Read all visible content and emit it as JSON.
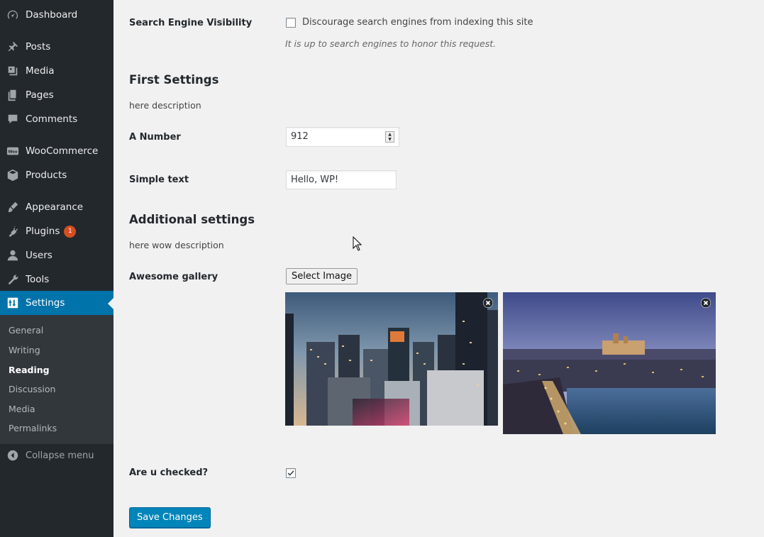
{
  "sidebar": {
    "items": [
      {
        "label": "Dashboard",
        "icon": "dashboard-icon"
      },
      {
        "label": "Posts",
        "icon": "pin-icon"
      },
      {
        "label": "Media",
        "icon": "media-icon"
      },
      {
        "label": "Pages",
        "icon": "pages-icon"
      },
      {
        "label": "Comments",
        "icon": "comment-icon"
      },
      {
        "label": "WooCommerce",
        "icon": "woocommerce-icon"
      },
      {
        "label": "Products",
        "icon": "products-icon"
      },
      {
        "label": "Appearance",
        "icon": "brush-icon"
      },
      {
        "label": "Plugins",
        "icon": "plugin-icon",
        "badge": "1"
      },
      {
        "label": "Users",
        "icon": "user-icon"
      },
      {
        "label": "Tools",
        "icon": "wrench-icon"
      },
      {
        "label": "Settings",
        "icon": "settings-icon",
        "active": true
      }
    ],
    "submenu": [
      "General",
      "Writing",
      "Reading",
      "Discussion",
      "Media",
      "Permalinks"
    ],
    "current_submenu": "Reading",
    "collapse_label": "Collapse menu",
    "accent_color": "#0073aa",
    "badge_color": "#d54e21"
  },
  "main": {
    "search_visibility": {
      "label": "Search Engine Visibility",
      "checkbox_label": "Discourage search engines from indexing this site",
      "checked": false,
      "description": "It is up to search engines to honor this request."
    },
    "first_settings": {
      "title": "First Settings",
      "description": "here description",
      "number_label": "A Number",
      "number_value": "912",
      "text_label": "Simple text",
      "text_value": "Hello, WP!"
    },
    "additional_settings": {
      "title": "Additional settings",
      "description": "here wow description",
      "gallery_label": "Awesome gallery",
      "select_button": "Select Image",
      "images": [
        "city-skyline-night",
        "prague-river-dusk"
      ],
      "checked_label": "Are u checked?",
      "checked": true
    },
    "save_button": "Save Changes",
    "primary_color": "#0085ba"
  }
}
